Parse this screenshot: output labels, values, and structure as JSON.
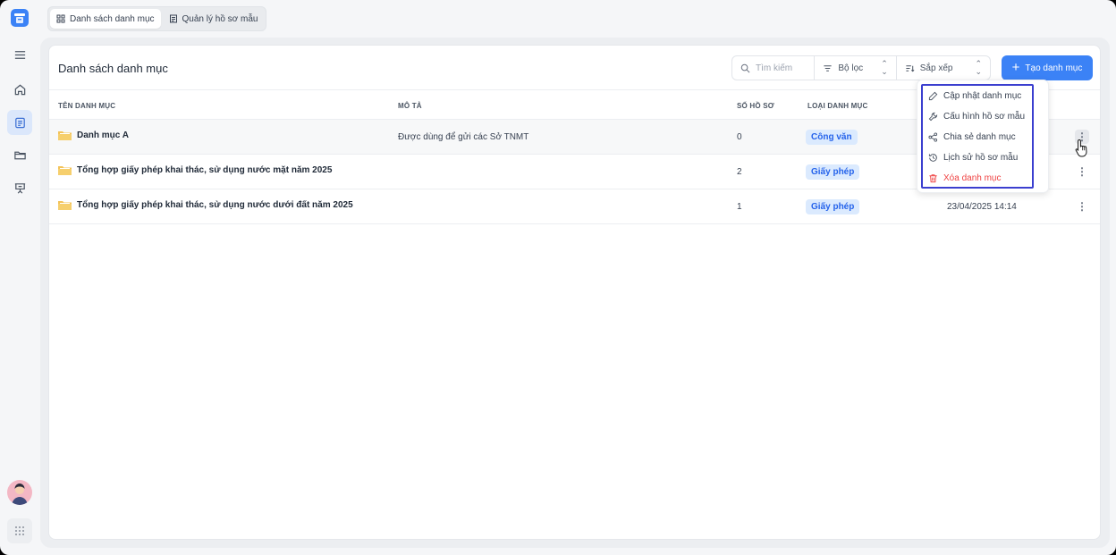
{
  "tabs": [
    {
      "label": "Danh sách danh mục",
      "icon": "list-grid-icon",
      "active": true
    },
    {
      "label": "Quản lý hồ sơ mẫu",
      "icon": "document-list-icon",
      "active": false
    }
  ],
  "page": {
    "title": "Danh sách danh mục"
  },
  "toolbar": {
    "search_placeholder": "Tìm kiếm",
    "filter_label": "Bộ lọc",
    "sort_label": "Sắp xếp",
    "create_label": "Tạo danh mục"
  },
  "table": {
    "headers": {
      "name": "TÊN DANH MỤC",
      "description": "MÔ TẢ",
      "count": "SỐ HỒ SƠ",
      "type": "LOẠI DANH MỤC"
    },
    "rows": [
      {
        "name": "Danh mục A",
        "description": "Được dùng để gửi các Sở TNMT",
        "count": "0",
        "type": "Công văn",
        "updated": ""
      },
      {
        "name": "Tổng hợp giấy phép khai thác, sử dụng nước mặt năm 2025",
        "description": "",
        "count": "2",
        "type": "Giấy phép",
        "updated": ""
      },
      {
        "name": "Tổng hợp giấy phép khai thác, sử dụng nước dưới đất năm 2025",
        "description": "",
        "count": "1",
        "type": "Giấy phép",
        "updated": "23/04/2025 14:14"
      }
    ]
  },
  "row_menu": {
    "items": [
      {
        "label": "Cập nhật danh mục",
        "icon": "pencil-icon"
      },
      {
        "label": "Cấu hình hồ sơ mẫu",
        "icon": "wrench-icon"
      },
      {
        "label": "Chia sẻ danh mục",
        "icon": "share-icon"
      },
      {
        "label": "Lịch sử hồ sơ mẫu",
        "icon": "history-icon"
      },
      {
        "label": "Xóa danh mục",
        "icon": "trash-icon",
        "danger": true
      }
    ]
  },
  "colors": {
    "accent": "#3b82f6",
    "badge_bg": "#dbeafe",
    "badge_text": "#2563eb",
    "danger": "#ef4444",
    "menu_focus": "#3b3fcf"
  },
  "icons": {
    "menu": "hamburger-icon",
    "home": "home-icon",
    "catalog": "calendar-list-icon",
    "folder": "folder-icon",
    "board": "presentation-icon",
    "apps": "apps-grid-icon"
  }
}
